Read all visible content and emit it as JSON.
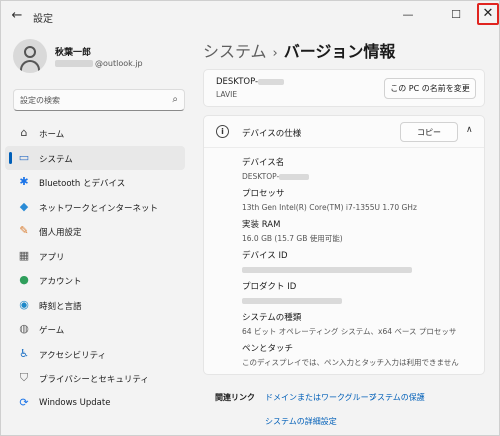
{
  "window": {
    "app_title": "設定",
    "back_glyph": "←",
    "min_glyph": "—",
    "max_glyph": "☐",
    "close_glyph": "✕"
  },
  "account": {
    "name": "秋葉一郎",
    "email_suffix": "@outlook.jp"
  },
  "search": {
    "placeholder": "設定の検索",
    "icon_glyph": "⌕"
  },
  "sidebar": {
    "items": [
      {
        "label": "ホーム",
        "icon": "home-icon",
        "glyph": "⌂",
        "color": "#444444"
      },
      {
        "label": "システム",
        "icon": "system-icon",
        "glyph": "▭",
        "color": "#2b6cc4",
        "active": true
      },
      {
        "label": "Bluetooth とデバイス",
        "icon": "bluetooth-icon",
        "glyph": "✱",
        "color": "#1a73e8"
      },
      {
        "label": "ネットワークとインターネット",
        "icon": "wifi-icon",
        "glyph": "◆",
        "color": "#2a8bd6"
      },
      {
        "label": "個人用設定",
        "icon": "brush-icon",
        "glyph": "✎",
        "color": "#d97a2b"
      },
      {
        "label": "アプリ",
        "icon": "apps-icon",
        "glyph": "▦",
        "color": "#555555"
      },
      {
        "label": "アカウント",
        "icon": "account-icon",
        "glyph": "●",
        "color": "#2e9e5b"
      },
      {
        "label": "時刻と言語",
        "icon": "globe-icon",
        "glyph": "◉",
        "color": "#1e88c8"
      },
      {
        "label": "ゲーム",
        "icon": "gamepad-icon",
        "glyph": "◍",
        "color": "#666666"
      },
      {
        "label": "アクセシビリティ",
        "icon": "accessibility-icon",
        "glyph": "♿",
        "color": "#1a6fc4"
      },
      {
        "label": "プライバシーとセキュリティ",
        "icon": "shield-icon",
        "glyph": "⛉",
        "color": "#666666"
      },
      {
        "label": "Windows Update",
        "icon": "update-icon",
        "glyph": "⟳",
        "color": "#1a73e8"
      }
    ]
  },
  "header": {
    "crumb": "システム",
    "separator": "›",
    "current": "バージョン情報"
  },
  "device": {
    "name_prefix": "DESKTOP-",
    "model": "LAVIE",
    "rename_label": "この PC の名前を変更"
  },
  "specs": {
    "title": "デバイスの仕様",
    "copy_label": "コピー",
    "info_glyph": "i",
    "collapse_glyph": "∧",
    "rows": [
      {
        "label": "デバイス名",
        "value": "DESKTOP-",
        "blur_after": 30
      },
      {
        "label": "プロセッサ",
        "value": "13th Gen Intel(R) Core(TM) i7-1355U   1.70 GHz"
      },
      {
        "label": "実装 RAM",
        "value": "16.0 GB (15.7 GB 使用可能)"
      },
      {
        "label": "デバイス ID",
        "value": "",
        "blur_after": 170
      },
      {
        "label": "プロダクト ID",
        "value": "",
        "blur_after": 100
      },
      {
        "label": "システムの種類",
        "value": "64 ビット オペレーティング システム、x64 ベース プロセッサ"
      },
      {
        "label": "ペンとタッチ",
        "value": "このディスプレイでは、ペン入力とタッチ入力は利用できません"
      }
    ]
  },
  "related": {
    "label": "関連リンク",
    "link_domain": "ドメインまたはワークグループ",
    "link_protect": "システムの保護",
    "link_advanced": "システムの詳細設定"
  },
  "colors": {
    "accent": "#005fb8",
    "close_highlight": "#e0241f"
  }
}
